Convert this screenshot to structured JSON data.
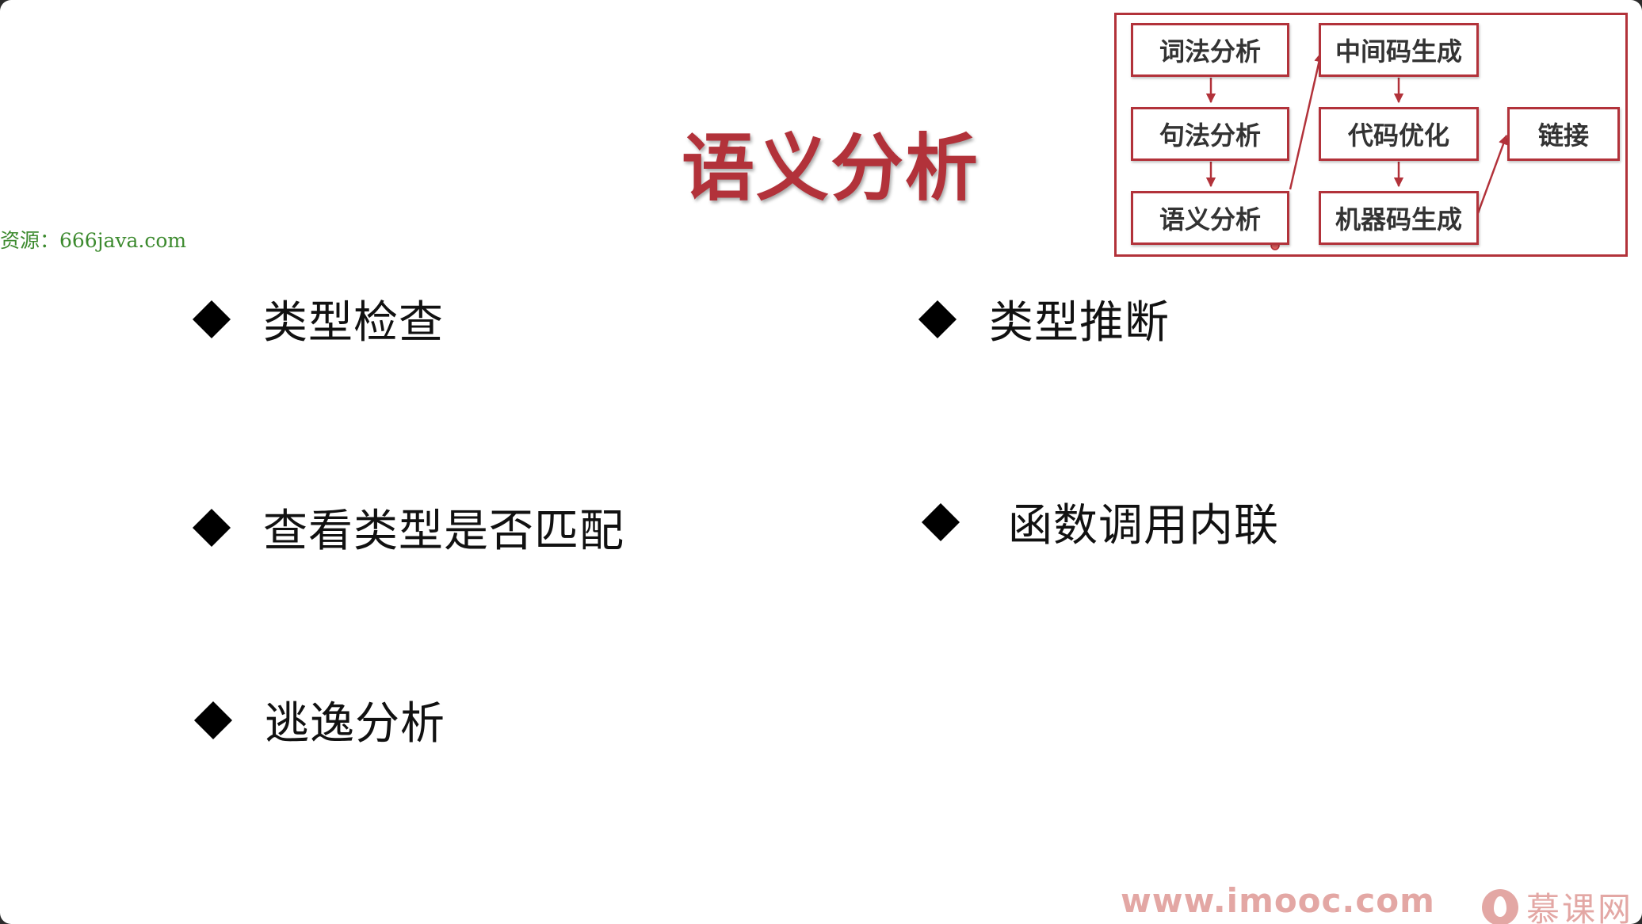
{
  "slide": {
    "title": "语义分析",
    "source_note": "资源：666java.com",
    "bullets": [
      "类型检查",
      "类型推断",
      "查看类型是否匹配",
      "函数调用内联",
      "逃逸分析"
    ]
  },
  "pipeline": {
    "stages": {
      "lexical": "词法分析",
      "syntax": "句法分析",
      "semantic": "语义分析",
      "ir_gen": "中间码生成",
      "optimize": "代码优化",
      "machine_gen": "机器码生成",
      "link": "链接"
    },
    "active_stage": "语义分析"
  },
  "footer": {
    "url": "www.imooc.com",
    "brand": "慕课网"
  },
  "colors": {
    "accent": "#b2323a",
    "watermark": "#e3a7a4",
    "source_note": "#3c8a2e"
  }
}
